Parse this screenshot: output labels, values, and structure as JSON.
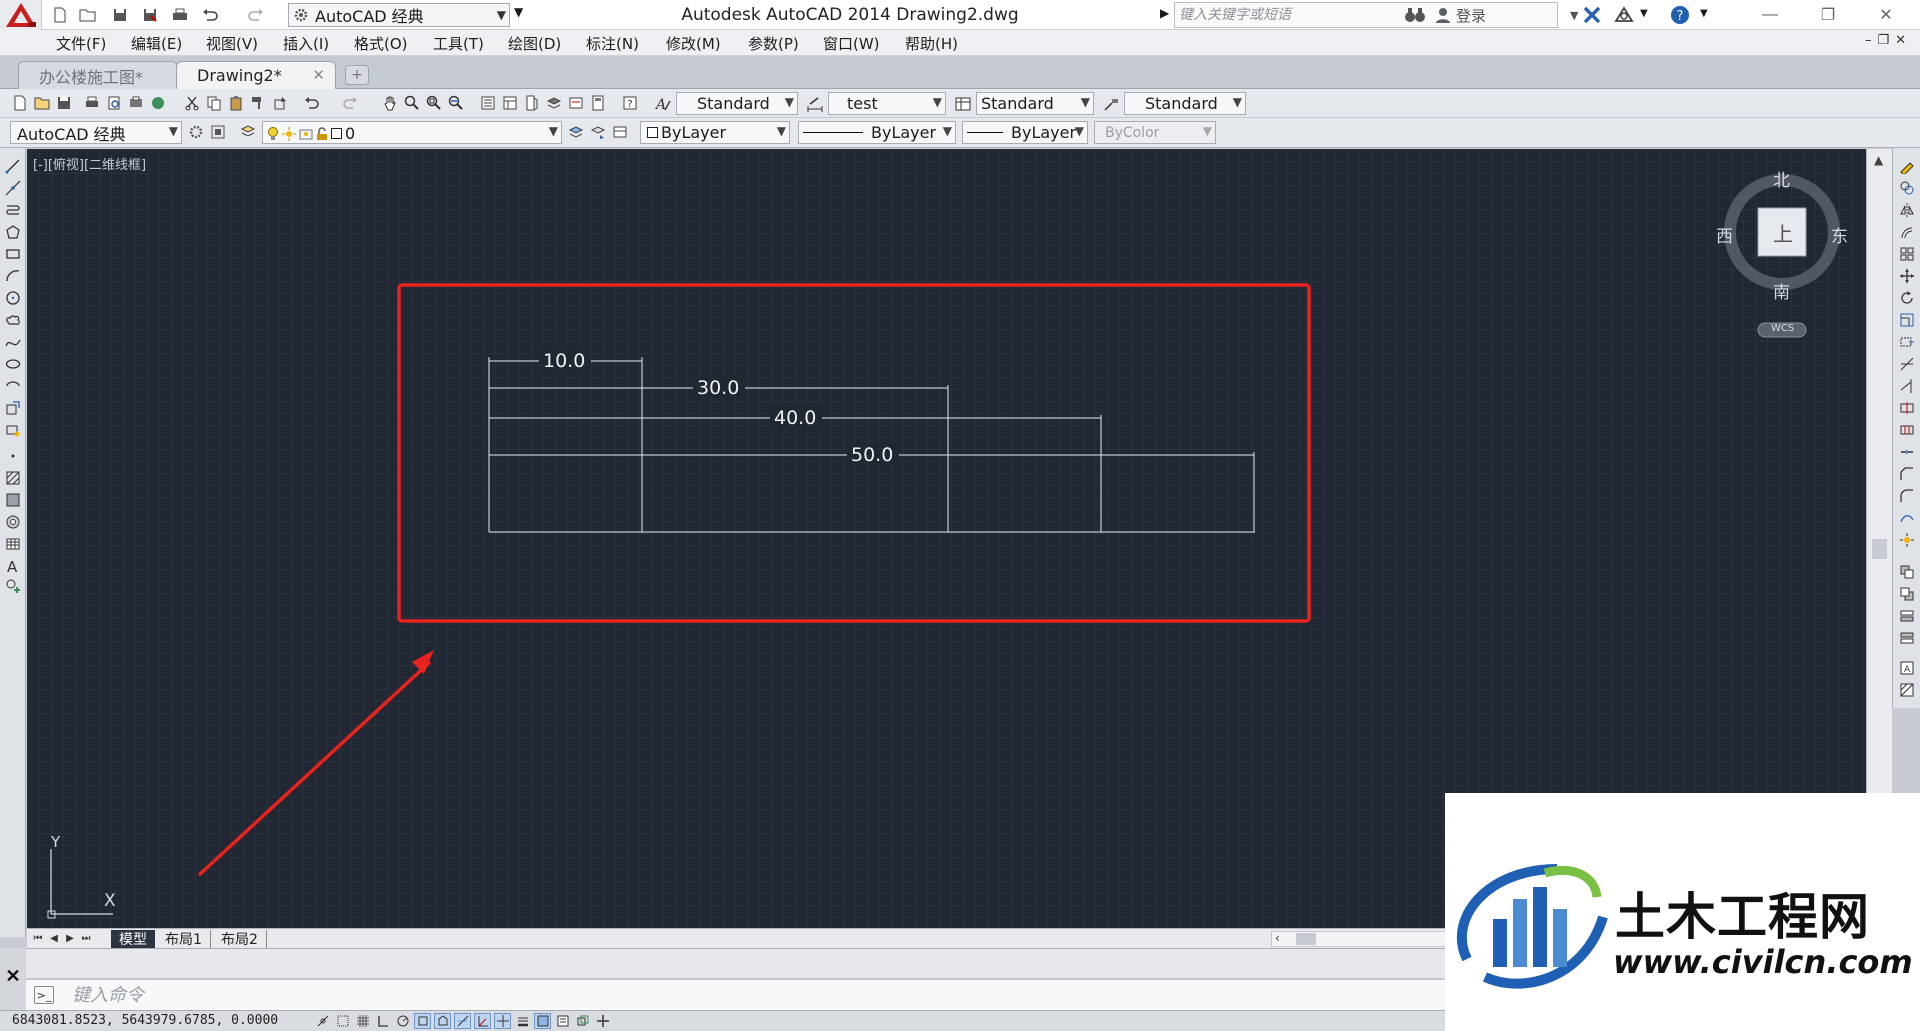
{
  "app": {
    "window_title": "Autodesk AutoCAD 2014    Drawing2.dwg",
    "workspace": "AutoCAD 经典",
    "search_placeholder": "键入关键字或短语",
    "login_label": "登录"
  },
  "menus": [
    "文件(F)",
    "编辑(E)",
    "视图(V)",
    "插入(I)",
    "格式(O)",
    "工具(T)",
    "绘图(D)",
    "标注(N)",
    "修改(M)",
    "参数(P)",
    "窗口(W)",
    "帮助(H)"
  ],
  "doc_tabs": [
    {
      "label": "办公楼施工图*",
      "active": false
    },
    {
      "label": "Drawing2*",
      "active": true
    }
  ],
  "styles": {
    "text_style": "Standard",
    "dim_style": "test",
    "table_style": "Standard",
    "multileader_style": "Standard"
  },
  "layer_bar": {
    "workspace": "AutoCAD 经典",
    "layer": "0",
    "color": "ByLayer",
    "linetype": "ByLayer",
    "lineweight": "ByLayer",
    "plotstyle": "ByColor"
  },
  "viewport": {
    "label": "[-][俯视][二维线框]"
  },
  "viewcube": {
    "north": "北",
    "south": "南",
    "east": "东",
    "west": "西",
    "face": "上",
    "wcs": "WCS"
  },
  "drawing": {
    "dimensions": [
      "10.0",
      "30.0",
      "40.0",
      "50.0"
    ],
    "ucs_x": "X",
    "ucs_y": "Y",
    "accent_color": "#e8221c"
  },
  "layout_tabs": [
    {
      "label": "模型",
      "active": true
    },
    {
      "label": "布局1",
      "active": false
    },
    {
      "label": "布局2",
      "active": false
    }
  ],
  "command": {
    "placeholder": "键入命令"
  },
  "status": {
    "coords": "6843081.8523, 5643979.6785, 0.0000"
  },
  "watermark": {
    "cn": "土木工程网",
    "url": "www.civilcn.com"
  }
}
